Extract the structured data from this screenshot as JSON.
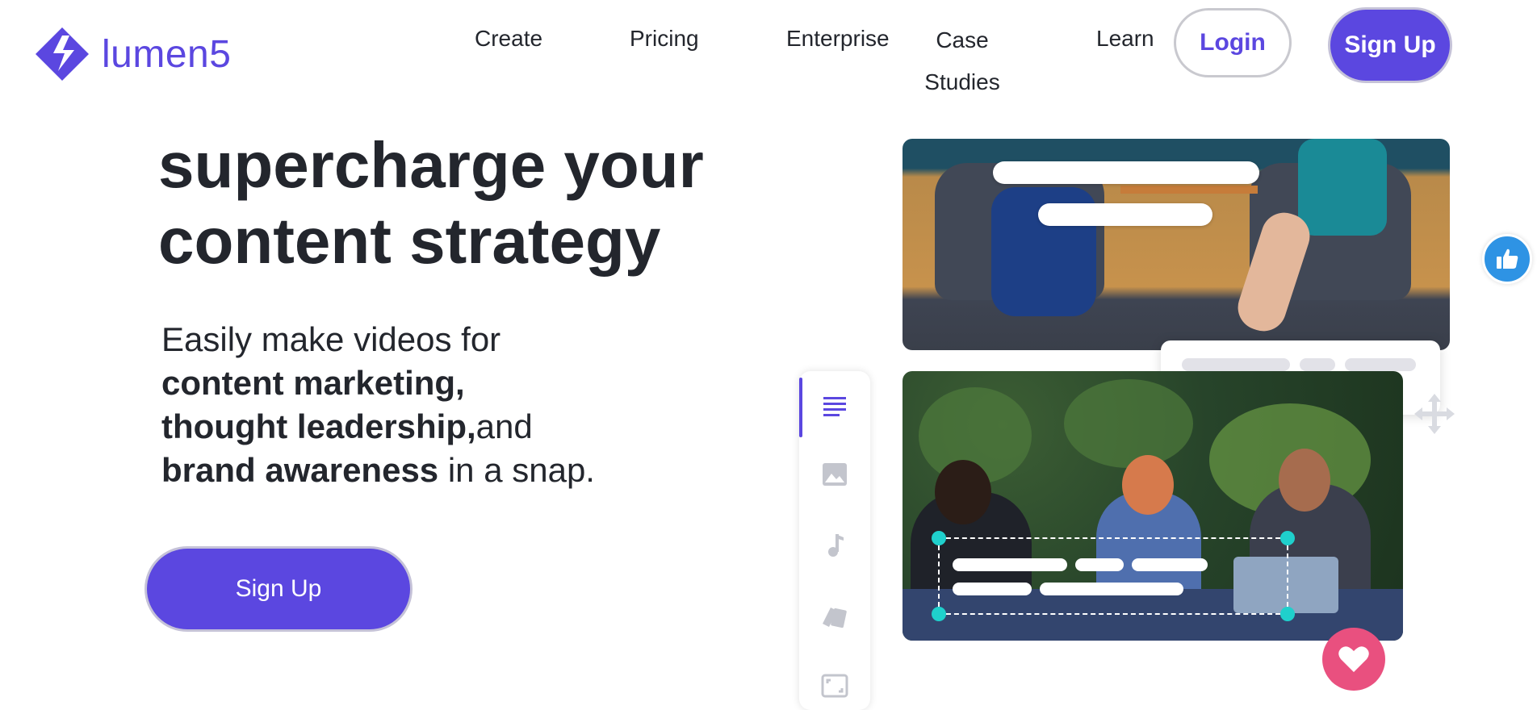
{
  "header": {
    "brand": "lumen5",
    "nav": [
      {
        "label": "Create"
      },
      {
        "label": "Pricing"
      },
      {
        "label": "Enterprise"
      },
      {
        "label": "Case Studies"
      },
      {
        "label": "Learn"
      }
    ],
    "login_label": "Login",
    "signup_label": "Sign Up"
  },
  "hero": {
    "title_line1": "supercharge your",
    "title_line2": "content strategy",
    "sub_intro": "Easily make videos for",
    "sub_bold1": "content marketing,",
    "sub_bold2": "thought leadership,",
    "sub_and": "and",
    "sub_bold3": "brand awareness",
    "sub_end": " in a snap.",
    "cta_label": "Sign Up"
  },
  "editor": {
    "tools": [
      "text-icon",
      "image-icon",
      "music-icon",
      "style-icon",
      "resize-icon"
    ],
    "badges": [
      "thumbs-up-icon",
      "heart-icon",
      "move-icon"
    ]
  },
  "colors": {
    "brand": "#5b47e0",
    "text": "#23262d",
    "like": "#2e93e4",
    "heart": "#e9507f",
    "handle": "#1fd0cc"
  }
}
